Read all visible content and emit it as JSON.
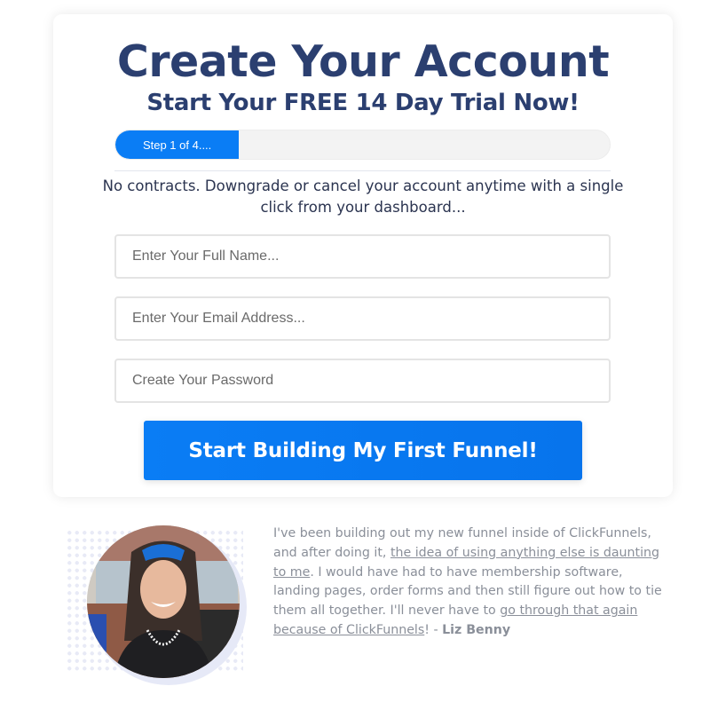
{
  "signup": {
    "title": "Create Your Account",
    "subtitle": "Start Your FREE 14 Day Trial Now!",
    "progress": {
      "label": "Step 1 of 4....",
      "current_step": 1,
      "total_steps": 4,
      "percent": 25
    },
    "note": "No contracts. Downgrade or cancel your account anytime with a single click from your dashboard...",
    "fields": {
      "name_placeholder": "Enter Your Full Name...",
      "email_placeholder": "Enter Your Email Address...",
      "password_placeholder": "Create Your Password"
    },
    "submit_label": "Start Building My First Funnel!"
  },
  "testimonial": {
    "segments": [
      {
        "text": "I've been building out my new funnel inside of ClickFunnels, and after doing it, ",
        "style": "plain"
      },
      {
        "text": "the idea of using anything else is daunting to me",
        "style": "underline"
      },
      {
        "text": ". I would have had to have membership software, landing pages, order forms and then still figure out how to tie them all together. I'll never have to ",
        "style": "plain"
      },
      {
        "text": "go through that again because of ClickFunnels",
        "style": "underline"
      },
      {
        "text": "! - ",
        "style": "plain"
      }
    ],
    "author": "Liz Benny",
    "avatar_icon": "person-photo"
  },
  "colors": {
    "heading": "#2b3f70",
    "accent": "#0a7df5",
    "quote_text": "#8a8f99"
  }
}
